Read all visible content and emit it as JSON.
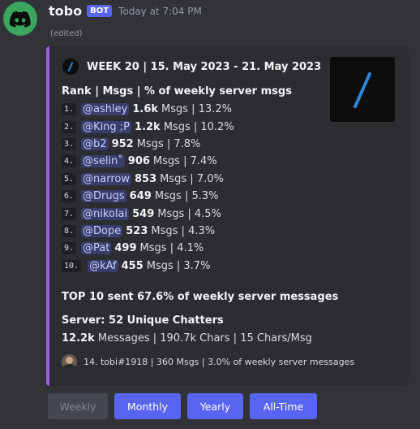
{
  "message": {
    "author": "tobo",
    "bot_tag": "BOT",
    "timestamp": "Today at 7:04 PM",
    "edited": "(edited)",
    "avatar_icon": "discord-logo-icon"
  },
  "embed": {
    "accent_color": "#a15be0",
    "week_title": "WEEK 20 | 15. May 2023 - 21. May 2023",
    "rank_header": "Rank | Msgs | % of weekly server msgs",
    "ranks": [
      {
        "num": "1.",
        "user": "@ashley",
        "msgs": "1.6k",
        "rest": "Msgs | 13.2%"
      },
      {
        "num": "2.",
        "user": "@King ;P",
        "msgs": "1.2k",
        "rest": "Msgs | 10.2%"
      },
      {
        "num": "3.",
        "user": "@b2",
        "msgs": "952",
        "rest": "Msgs | 7.8%"
      },
      {
        "num": "4.",
        "user": "@selin˚",
        "msgs": "906",
        "rest": "Msgs | 7.4%"
      },
      {
        "num": "5.",
        "user": "@narrow",
        "msgs": "853",
        "rest": "Msgs | 7.0%"
      },
      {
        "num": "6.",
        "user": "@Drugs",
        "msgs": "649",
        "rest": "Msgs | 5.3%"
      },
      {
        "num": "7.",
        "user": "@nikolai",
        "msgs": "549",
        "rest": "Msgs | 4.5%"
      },
      {
        "num": "8.",
        "user": "@Dope",
        "msgs": "523",
        "rest": "Msgs | 4.3%"
      },
      {
        "num": "9.",
        "user": "@Pat",
        "msgs": "499",
        "rest": "Msgs | 4.1%"
      },
      {
        "num": "10.",
        "user": "@kAf",
        "msgs": "455",
        "rest": "Msgs | 3.7%"
      }
    ],
    "top10_text": "TOP 10 sent 67.6% of weekly server messages",
    "server_title": "Server: 52 Unique Chatters",
    "stats_bold": "12.2k",
    "stats_rest": "Messages | 190.7k Chars | 15 Chars/Msg",
    "footer_text": "14. tobi#1918 | 360 Msgs | 3.0% of weekly server messages"
  },
  "buttons": {
    "weekly": "Weekly",
    "monthly": "Monthly",
    "yearly": "Yearly",
    "alltime": "All-Time"
  }
}
